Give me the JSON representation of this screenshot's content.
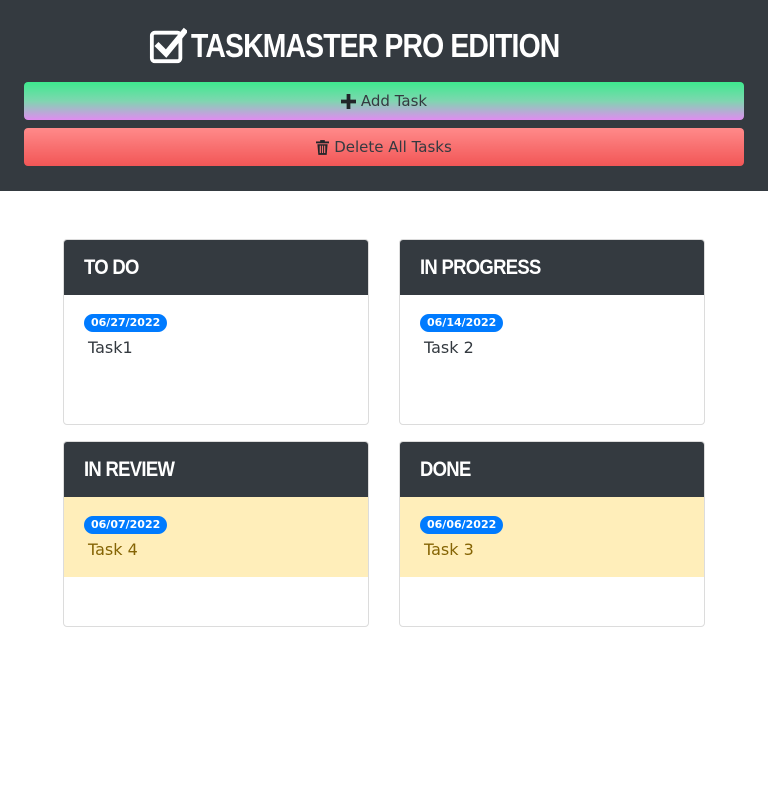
{
  "header": {
    "title": "TASKMASTER PRO EDITION",
    "add_label": "Add Task",
    "delete_label": "Delete All Tasks"
  },
  "lanes": [
    {
      "title": "TO DO",
      "tasks": [
        {
          "date": "06/27/2022",
          "name": "Task1",
          "highlight": false
        }
      ]
    },
    {
      "title": "IN PROGRESS",
      "tasks": [
        {
          "date": "06/14/2022",
          "name": "Task 2",
          "highlight": false
        }
      ]
    },
    {
      "title": "IN REVIEW",
      "tasks": [
        {
          "date": "06/07/2022",
          "name": "Task 4",
          "highlight": true
        }
      ]
    },
    {
      "title": "DONE",
      "tasks": [
        {
          "date": "06/06/2022",
          "name": "Task 3",
          "highlight": true
        }
      ]
    }
  ],
  "colors": {
    "header_bg": "#343a40",
    "badge": "#007bff",
    "highlight_card": "#ffeeba",
    "delete_button": "#f25656"
  },
  "icons": {
    "title": "checkbox-icon",
    "add": "plus-icon",
    "delete": "trash-icon"
  }
}
